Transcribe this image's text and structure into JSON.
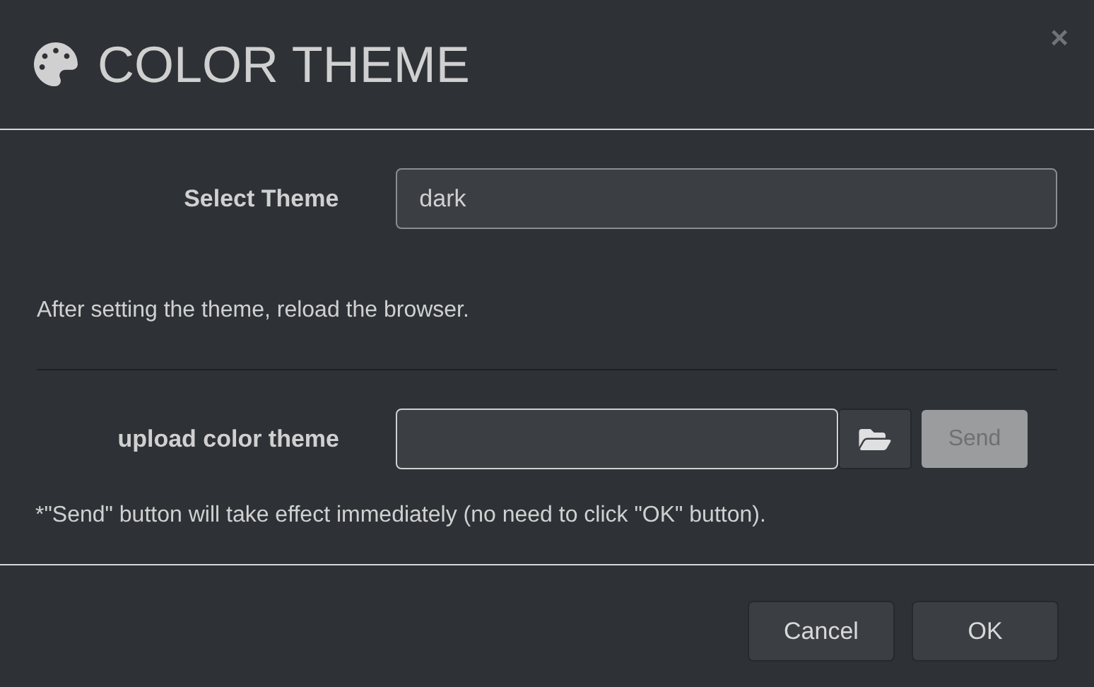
{
  "dialog": {
    "title": "COLOR THEME",
    "close": "×"
  },
  "theme_select": {
    "label": "Select Theme",
    "value": "dark"
  },
  "reload_note": "After setting the theme, reload the browser.",
  "upload": {
    "label": "upload color theme",
    "send": {
      "label": "Send",
      "disabled": true
    }
  },
  "send_note": "*\"Send\" button will take effect immediately (no need to click \"OK\" button).",
  "buttons": [
    {
      "label": "Cancel"
    },
    {
      "label": "OK"
    }
  ]
}
